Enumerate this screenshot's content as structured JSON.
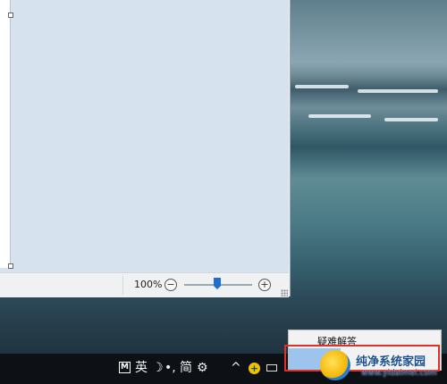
{
  "statusbar": {
    "zoom_text": "100%",
    "zoom_out": "−",
    "zoom_in": "+"
  },
  "taskbar": {
    "ime_badge": "M",
    "ime_lang": "英",
    "ime_mode_moon": "☽",
    "ime_punct": "•,",
    "ime_simplified": "简",
    "ime_settings": "⚙",
    "tray_chevron": "^"
  },
  "context_menu": {
    "item_label": "疑难解答"
  },
  "watermark": {
    "title": "纯净系统家园",
    "url": "www.yidaimei.com"
  },
  "colors": {
    "selection_highlight": "#9cc4ec",
    "annotation_frame": "#e0302a",
    "zoom_thumb": "#1f6fd1"
  }
}
